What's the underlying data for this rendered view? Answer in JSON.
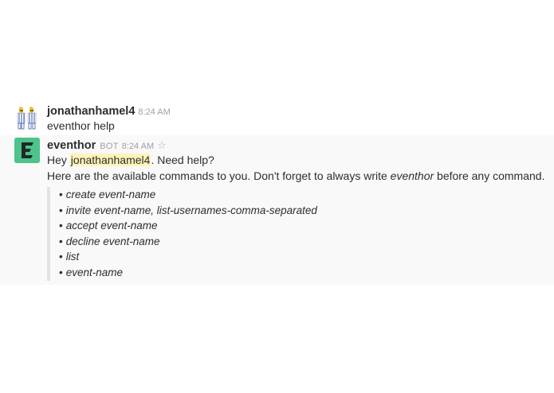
{
  "messages": [
    {
      "sender": "jonathanhamel4",
      "timestamp": "8:24 AM",
      "text": "eventhor help",
      "avatar_icon": "bananas-in-pajamas-avatar-icon"
    },
    {
      "sender": "eventhor",
      "bot_tag": "BOT",
      "timestamp": "8:24 AM",
      "star_icon": "☆",
      "avatar_icon": "eventhor-logo-icon",
      "avatar_color": "#4ec38b",
      "greeting_prefix": "Hey ",
      "mention": "jonathanhamel4",
      "greeting_suffix": ". Need help?",
      "intro_prefix": "Here are the available commands to you. Don't forget to always write ",
      "intro_em": "eventhor",
      "intro_suffix": " before any command.",
      "commands": [
        "create event-name",
        "invite event-name, list-usernames-comma-separated",
        "accept event-name",
        "decline event-name",
        "list",
        "event-name"
      ]
    }
  ],
  "colors": {
    "mention_highlight": "#fff4b8",
    "bot_message_bg": "#f9f9f9",
    "attachment_bar": "#e3e3e3"
  }
}
